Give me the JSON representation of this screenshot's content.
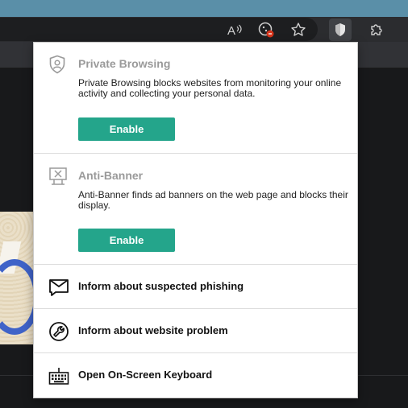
{
  "toolbar": {
    "icons": [
      "read-aloud-icon",
      "tracking-prevention-icon",
      "favorites-star-icon",
      "kaspersky-shield-icon",
      "extensions-puzzle-icon"
    ]
  },
  "popup": {
    "private_browsing": {
      "title": "Private Browsing",
      "description": "Private Browsing blocks websites from monitoring your online activity and collecting your personal data.",
      "button": "Enable"
    },
    "anti_banner": {
      "title": "Anti-Banner",
      "description": "Anti-Banner finds ad banners on the web page and blocks their display.",
      "button": "Enable"
    },
    "actions": [
      {
        "label": "Inform about suspected phishing",
        "icon": "envelope-icon"
      },
      {
        "label": "Inform about website problem",
        "icon": "wrench-icon"
      },
      {
        "label": "Open On-Screen Keyboard",
        "icon": "keyboard-icon"
      }
    ]
  },
  "colors": {
    "accent": "#24a58b",
    "title_gray": "#9a9a9a",
    "toolbar": "#2b2c2f"
  }
}
